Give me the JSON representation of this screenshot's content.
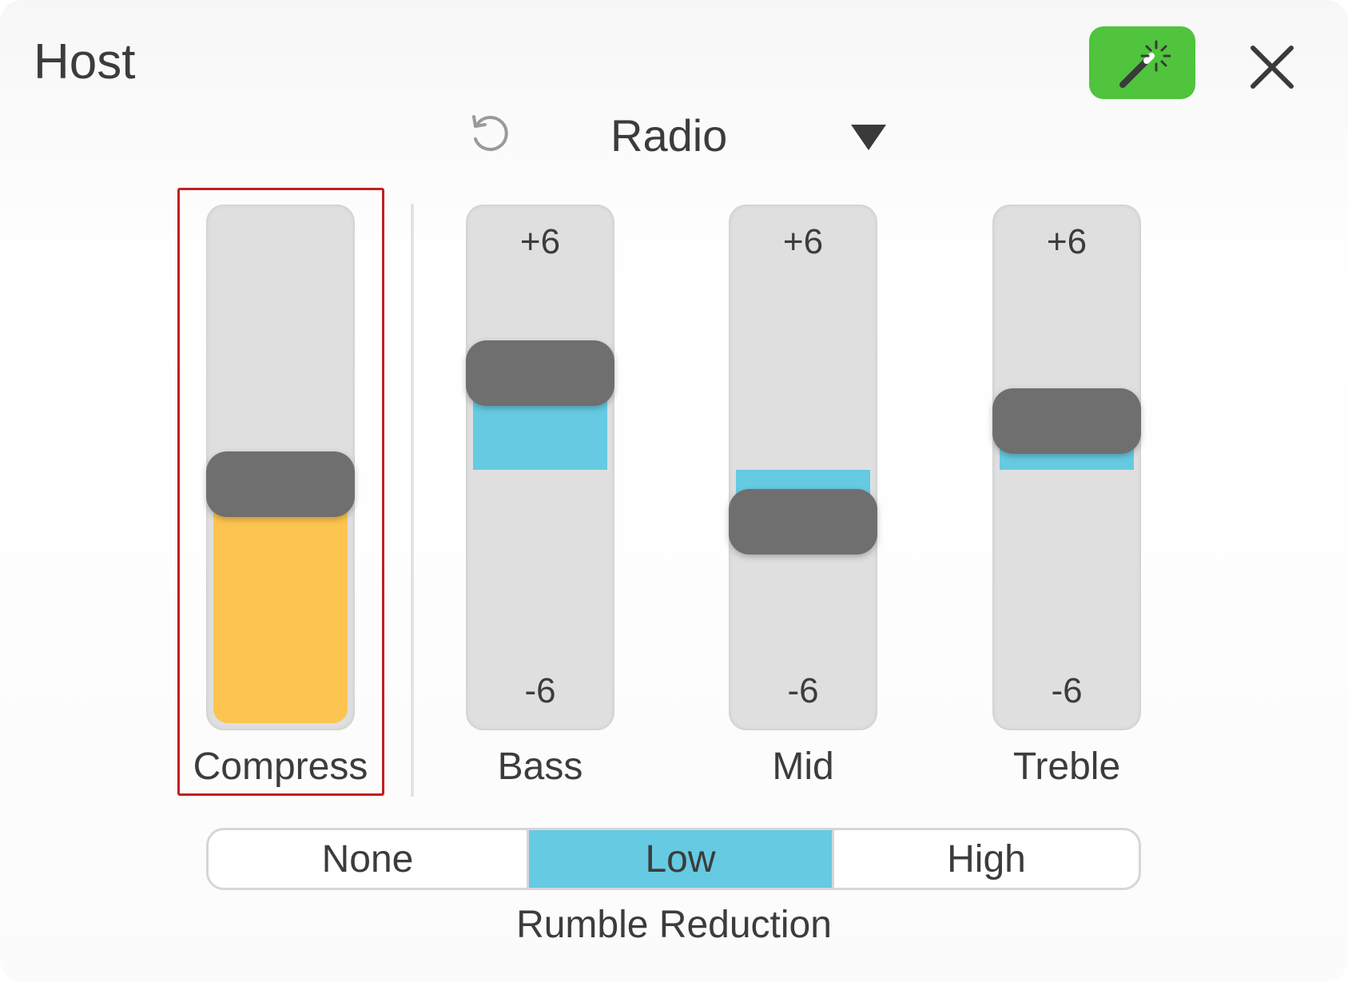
{
  "window": {
    "title": "Host"
  },
  "toolbar": {
    "magic_icon": "magic-wand-icon",
    "close_icon": "close-icon",
    "undo_icon": "undo-icon"
  },
  "preset": {
    "selected": "Radio",
    "arrow_icon": "dropdown-arrow-icon"
  },
  "sliders": {
    "compress": {
      "label": "Compress",
      "value_fraction": 0.47,
      "fill_color": "#fec450"
    },
    "bass": {
      "label": "Bass",
      "max_label": "+6",
      "min_label": "-6",
      "value": 2.6,
      "fill_color": "#66cae3"
    },
    "mid": {
      "label": "Mid",
      "max_label": "+6",
      "min_label": "-6",
      "value": -1.4,
      "fill_color": "#66cae3"
    },
    "treble": {
      "label": "Treble",
      "max_label": "+6",
      "min_label": "-6",
      "value": 1.3,
      "fill_color": "#66cae3"
    }
  },
  "rumble": {
    "options": [
      "None",
      "Low",
      "High"
    ],
    "selected": "Low",
    "caption": "Rumble Reduction"
  },
  "colors": {
    "accent_green": "#4fc43c",
    "selected_blue": "#66cae3",
    "thumb_gray": "#6f6f6f",
    "highlight_red": "#c0201f"
  }
}
